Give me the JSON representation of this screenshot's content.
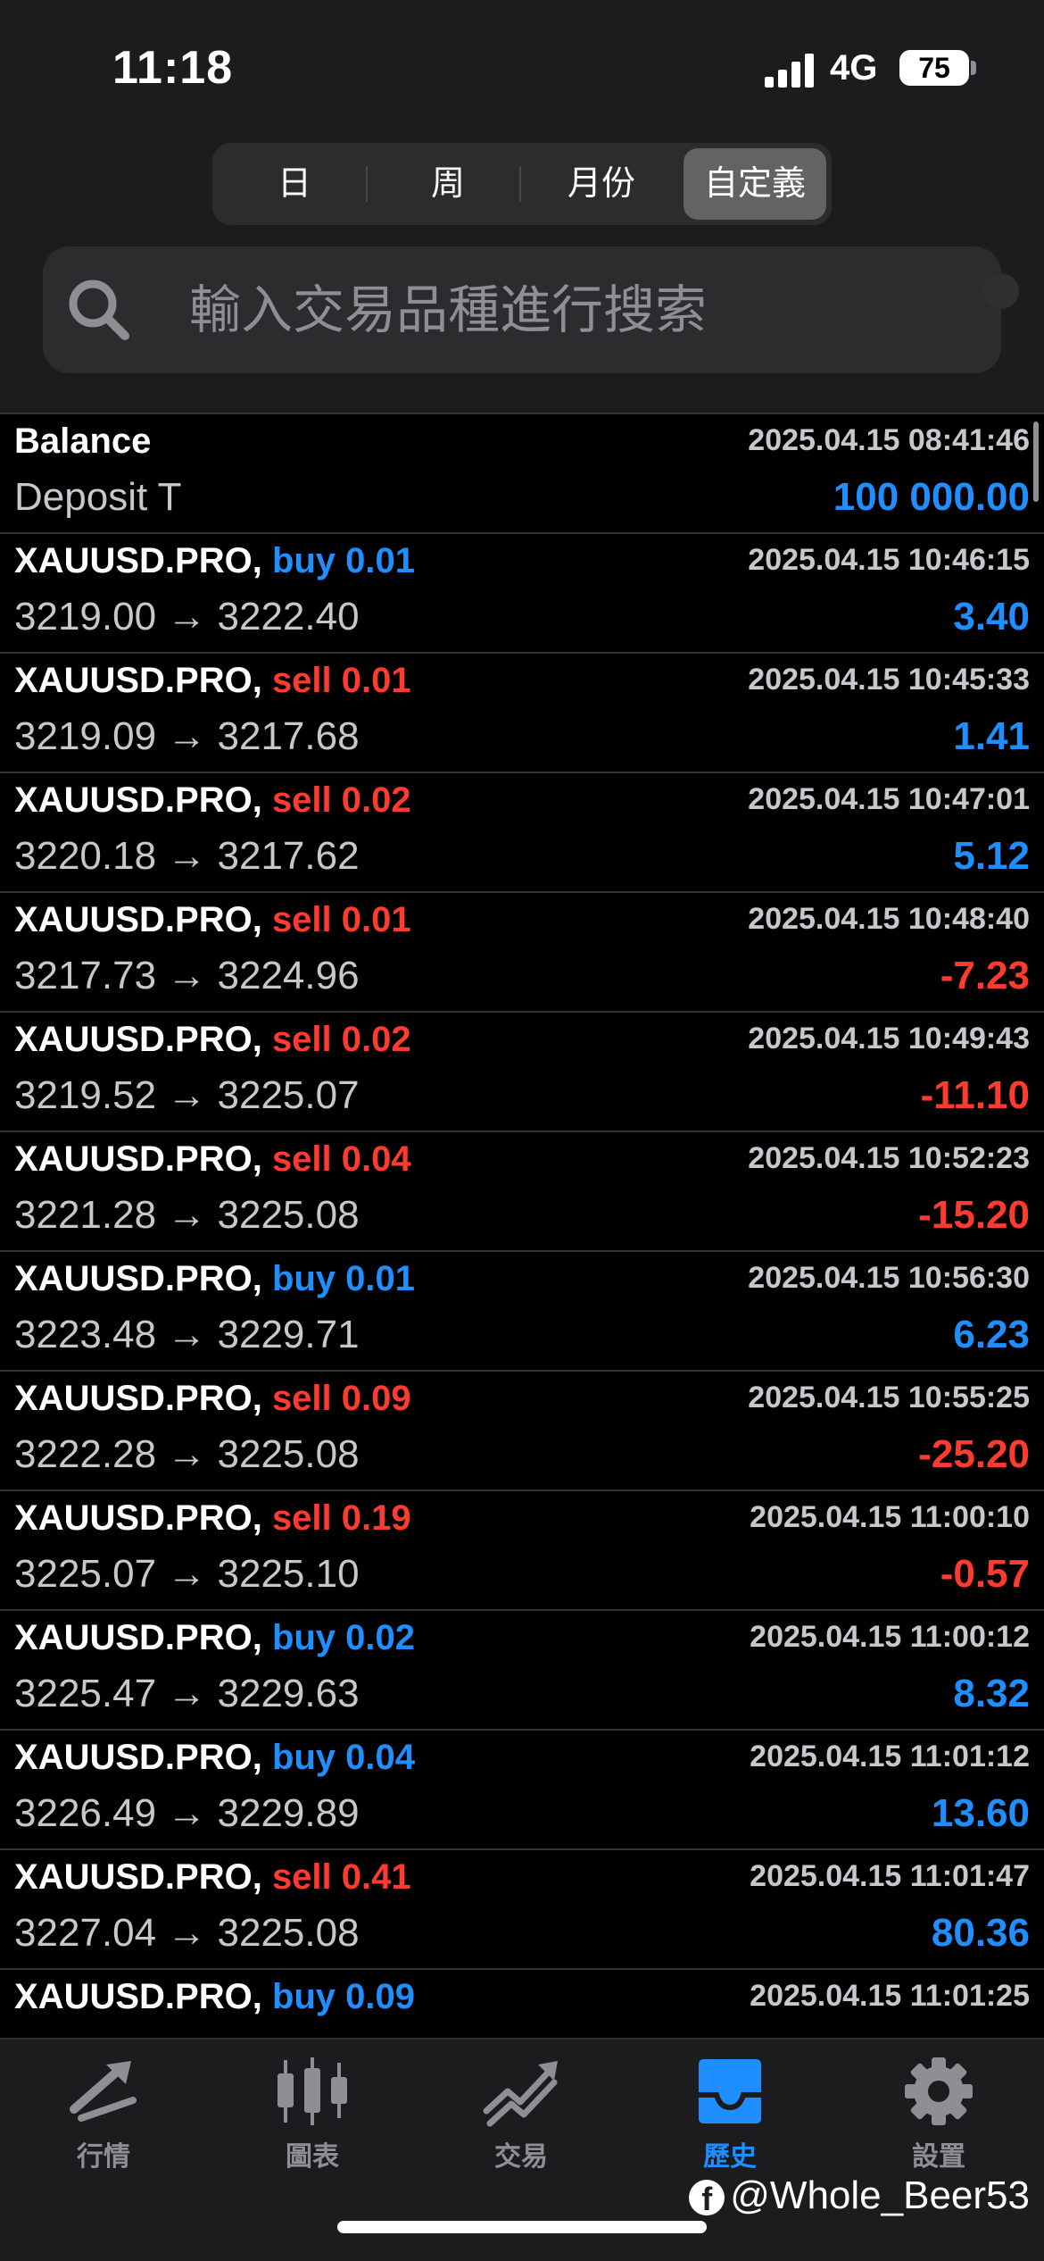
{
  "status": {
    "time": "11:18",
    "network": "4G",
    "battery": "75"
  },
  "segments": [
    {
      "label": "日",
      "active": false
    },
    {
      "label": "周",
      "active": false
    },
    {
      "label": "月份",
      "active": false
    },
    {
      "label": "自定義",
      "active": true
    }
  ],
  "search": {
    "placeholder": "輸入交易品種進行搜索"
  },
  "balance": {
    "title": "Balance",
    "date": "2025.04.15 08:41:46",
    "subtitle": "Deposit T",
    "amount": "100 000.00"
  },
  "rows": [
    {
      "symbol": "XAUUSD.PRO,",
      "side": "buy 0.01",
      "side_color": "blue",
      "date": "2025.04.15 10:46:15",
      "prices": "3219.00 → 3222.40",
      "pnl": "3.40",
      "pnl_color": "blue"
    },
    {
      "symbol": "XAUUSD.PRO,",
      "side": "sell 0.01",
      "side_color": "red",
      "date": "2025.04.15 10:45:33",
      "prices": "3219.09 → 3217.68",
      "pnl": "1.41",
      "pnl_color": "blue"
    },
    {
      "symbol": "XAUUSD.PRO,",
      "side": "sell 0.02",
      "side_color": "red",
      "date": "2025.04.15 10:47:01",
      "prices": "3220.18 → 3217.62",
      "pnl": "5.12",
      "pnl_color": "blue"
    },
    {
      "symbol": "XAUUSD.PRO,",
      "side": "sell 0.01",
      "side_color": "red",
      "date": "2025.04.15 10:48:40",
      "prices": "3217.73 → 3224.96",
      "pnl": "-7.23",
      "pnl_color": "red"
    },
    {
      "symbol": "XAUUSD.PRO,",
      "side": "sell 0.02",
      "side_color": "red",
      "date": "2025.04.15 10:49:43",
      "prices": "3219.52 → 3225.07",
      "pnl": "-11.10",
      "pnl_color": "red"
    },
    {
      "symbol": "XAUUSD.PRO,",
      "side": "sell 0.04",
      "side_color": "red",
      "date": "2025.04.15 10:52:23",
      "prices": "3221.28 → 3225.08",
      "pnl": "-15.20",
      "pnl_color": "red"
    },
    {
      "symbol": "XAUUSD.PRO,",
      "side": "buy 0.01",
      "side_color": "blue",
      "date": "2025.04.15 10:56:30",
      "prices": "3223.48 → 3229.71",
      "pnl": "6.23",
      "pnl_color": "blue"
    },
    {
      "symbol": "XAUUSD.PRO,",
      "side": "sell 0.09",
      "side_color": "red",
      "date": "2025.04.15 10:55:25",
      "prices": "3222.28 → 3225.08",
      "pnl": "-25.20",
      "pnl_color": "red"
    },
    {
      "symbol": "XAUUSD.PRO,",
      "side": "sell 0.19",
      "side_color": "red",
      "date": "2025.04.15 11:00:10",
      "prices": "3225.07 → 3225.10",
      "pnl": "-0.57",
      "pnl_color": "red"
    },
    {
      "symbol": "XAUUSD.PRO,",
      "side": "buy 0.02",
      "side_color": "blue",
      "date": "2025.04.15 11:00:12",
      "prices": "3225.47 → 3229.63",
      "pnl": "8.32",
      "pnl_color": "blue"
    },
    {
      "symbol": "XAUUSD.PRO,",
      "side": "buy 0.04",
      "side_color": "blue",
      "date": "2025.04.15 11:01:12",
      "prices": "3226.49 → 3229.89",
      "pnl": "13.60",
      "pnl_color": "blue"
    },
    {
      "symbol": "XAUUSD.PRO,",
      "side": "sell 0.41",
      "side_color": "red",
      "date": "2025.04.15 11:01:47",
      "prices": "3227.04 → 3225.08",
      "pnl": "80.36",
      "pnl_color": "blue"
    },
    {
      "symbol": "XAUUSD.PRO,",
      "side": "buy 0.09",
      "side_color": "blue",
      "date": "2025.04.15 11:01:25",
      "prices": "",
      "pnl": "",
      "pnl_color": "blue"
    }
  ],
  "tabs": [
    {
      "label": "行情",
      "icon": "quotes-icon",
      "active": false
    },
    {
      "label": "圖表",
      "icon": "chart-icon",
      "active": false
    },
    {
      "label": "交易",
      "icon": "trade-icon",
      "active": false
    },
    {
      "label": "歷史",
      "icon": "history-icon",
      "active": true
    },
    {
      "label": "設置",
      "icon": "settings-icon",
      "active": false
    }
  ],
  "watermark": "@Whole_Beer53",
  "colors": {
    "blue": "#1f8fff",
    "red": "#ff3b30",
    "inactive": "#8e8e93"
  }
}
